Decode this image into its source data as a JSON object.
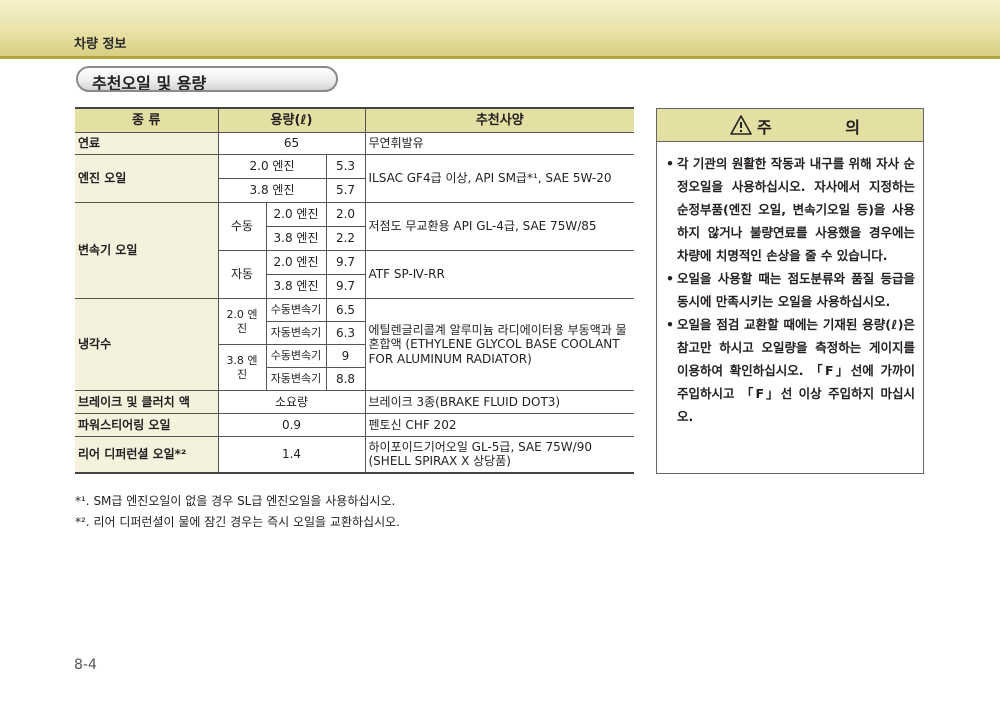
{
  "header": {
    "section": "차량 정보"
  },
  "title": "추천오일 및 용량",
  "table": {
    "headers": {
      "type": "종 류",
      "capacity": "용량(ℓ)",
      "spec": "추천사양"
    },
    "fuel": {
      "name": "연료",
      "capacity": "65",
      "spec": "무연휘발유"
    },
    "engine_oil": {
      "name": "엔진 오일",
      "rows": [
        {
          "engine": "2.0 엔진",
          "capacity": "5.3"
        },
        {
          "engine": "3.8 엔진",
          "capacity": "5.7"
        }
      ],
      "spec": "ILSAC GF4급 이상, API SM급*¹, SAE 5W-20"
    },
    "transmission": {
      "name": "변속기 오일",
      "manual": {
        "label": "수동",
        "rows": [
          {
            "engine": "2.0 엔진",
            "capacity": "2.0"
          },
          {
            "engine": "3.8 엔진",
            "capacity": "2.2"
          }
        ],
        "spec": "저점도 무교환용 API GL-4급,  SAE 75W/85"
      },
      "auto": {
        "label": "자동",
        "rows": [
          {
            "engine": "2.0 엔진",
            "capacity": "9.7"
          },
          {
            "engine": "3.8 엔진",
            "capacity": "9.7"
          }
        ],
        "spec": "ATF SP-Ⅳ-RR"
      }
    },
    "coolant": {
      "name": "냉각수",
      "groups": [
        {
          "engine": "2.0 엔진",
          "rows": [
            {
              "trans": "수동변속기",
              "capacity": "6.5"
            },
            {
              "trans": "자동변속기",
              "capacity": "6.3"
            }
          ]
        },
        {
          "engine": "3.8 엔진",
          "rows": [
            {
              "trans": "수동변속기",
              "capacity": "9"
            },
            {
              "trans": "자동변속기",
              "capacity": "8.8"
            }
          ]
        }
      ],
      "spec": "에틸렌글리콜계 알루미늄 라디에이터용 부동액과 물 혼합액 (ETHYLENE GLYCOL BASE COOLANT FOR ALUMINUM RADIATOR)"
    },
    "brake": {
      "name": "브레이크 및 클러치 액",
      "capacity": "소요량",
      "spec": "브레이크 3종(BRAKE FLUID DOT3)"
    },
    "power_steering": {
      "name": "파워스티어링 오일",
      "capacity": "0.9",
      "spec": "펜토신 CHF 202"
    },
    "diff": {
      "name": "리어 디퍼런셜 오일*²",
      "capacity": "1.4",
      "spec": "하이포이드기어오일 GL-5급, SAE 75W/90 (SHELL SPIRAX X 상당품)"
    }
  },
  "footnotes": [
    "*¹. SM급 엔진오일이 없을 경우 SL급 엔진오일을 사용하십시오.",
    "*². 리어 디퍼런셜이 물에 잠긴 경우는 즉시 오일을 교환하십시오."
  ],
  "caution": {
    "title": "주 의",
    "icon": "warning-triangle-icon",
    "items": [
      "각 기관의 원활한 작동과 내구를 위해 자사 순정오일을 사용하십시오. 자사에서 지정하는 순정부품(엔진 오일, 변속기오일 등)을 사용하지 않거나 불량연료를 사용했을 경우에는 차량에 치명적인 손상을 줄 수 있습니다.",
      "오일을 사용할 때는 점도분류와 품질 등급을 동시에 만족시키는 오일을 사용하십시오.",
      "오일을 점검 교환할 때에는 기재된 용량(ℓ)은 참고만 하시고 오일량을 측정하는 게이지를 이용하여 확인하십시오. 「F」선에 가까이 주입하시고 「F」선 이상 주입하지 마십시오."
    ]
  },
  "page_number": "8-4",
  "colors": {
    "header_band": "#e9e2a9",
    "header_line": "#b1a540",
    "table_header": "#e4dfa3"
  }
}
